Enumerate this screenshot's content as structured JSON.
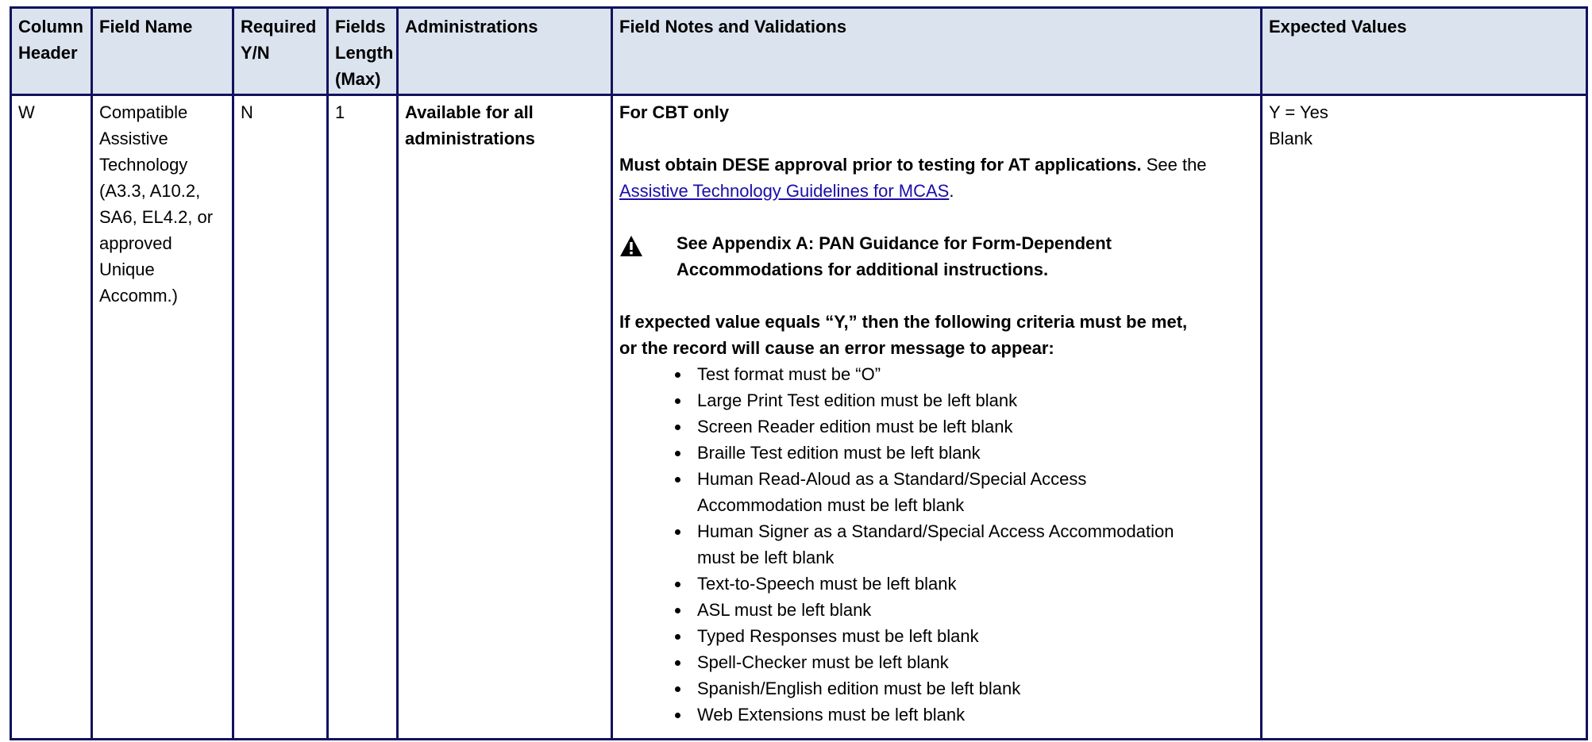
{
  "headers": {
    "column_header": "Column Header",
    "field_name": "Field Name",
    "required": "Required Y/N",
    "fields_length": "Fields Length (Max)",
    "administrations": "Administrations",
    "field_notes": "Field Notes and Validations",
    "expected_values": "Expected  Values"
  },
  "row": {
    "column_header": "W",
    "field_name": "Compatible Assistive Technology (A3.3, A10.2, SA6, EL4.2, or approved Unique Accomm.)",
    "required": "N",
    "fields_length": "1",
    "administrations": "Available for all administrations",
    "notes": {
      "cbt_only": "For CBT only",
      "approval_bold": "Must obtain DESE approval prior to testing for AT applications.",
      "approval_see": " See the ",
      "link_text": "Assistive Technology Guidelines for MCAS",
      "link_period": ".",
      "warning_icon": "warning-triangle-icon",
      "appendix_note": "See Appendix A: PAN Guidance for Form-Dependent Accommodations for additional instructions.",
      "criteria_intro": "If expected value equals “Y,” then the following criteria must be met, or the record will cause an error message to appear:",
      "criteria": [
        "Test format must be “O”",
        "Large Print Test edition must be left blank",
        "Screen Reader edition must be left blank",
        "Braille Test edition must be left blank",
        "Human Read-Aloud as a Standard/Special Access Accommodation must be left blank",
        "Human Signer as a Standard/Special Access Accommodation must be left blank",
        "Text-to-Speech must be left blank",
        "ASL must be left blank",
        "Typed Responses must be left blank",
        "Spell-Checker must be left blank",
        "Spanish/English edition must be left blank",
        "Web Extensions must be left blank"
      ]
    },
    "expected_values": [
      "Y = Yes",
      "Blank"
    ]
  },
  "colors": {
    "header_bg": "#dbe3ee",
    "border": "#12125e",
    "link": "#1a0dab"
  }
}
